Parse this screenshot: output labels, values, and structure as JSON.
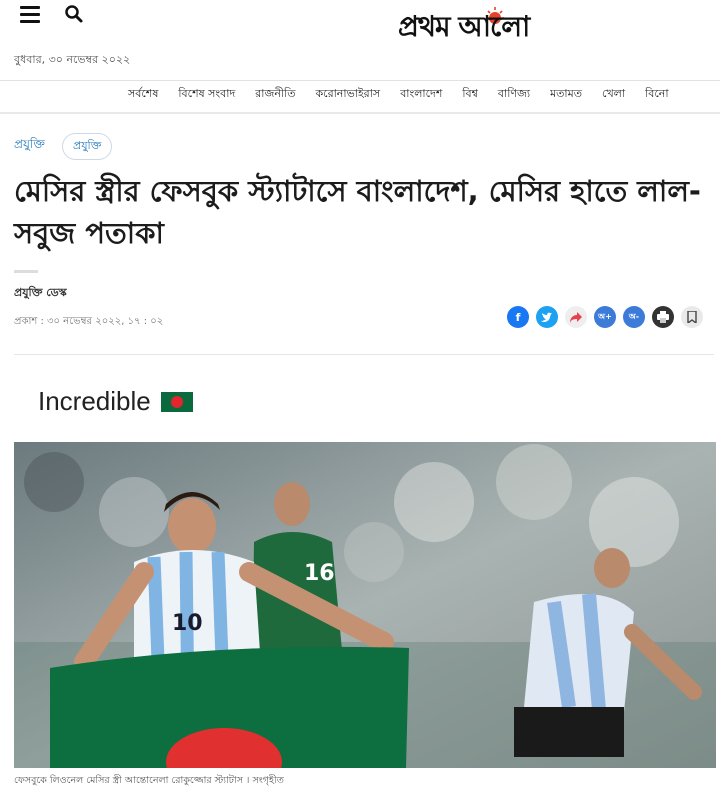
{
  "header": {
    "logo_text": "প্রথম আলো",
    "date": "বুধবার, ৩০ নভেম্বর ২০২২"
  },
  "nav": {
    "items": [
      "সর্বশেষ",
      "বিশেষ সংবাদ",
      "রাজনীতি",
      "করোনাভাইরাস",
      "বাংলাদেশ",
      "বিশ্ব",
      "বাণিজ্য",
      "মতামত",
      "খেলা",
      "বিনো"
    ]
  },
  "article": {
    "category_link": "প্রযুক্তি",
    "category_pill": "প্রযুক্তি",
    "headline": "মেসির স্ত্রীর ফেসবুক স্ট্যাটাসে বাংলাদেশ, মেসির হাতে লাল-সবুজ পতাকা",
    "author": "প্রযুক্তি ডেস্ক",
    "published": "প্রকাশ : ৩০ নভেম্বর ২০২২, ১৭ : ০২",
    "embed_text": "Incredible",
    "caption": "ফেসবুকে লিওনেল মেসির স্ত্রী আন্তোনেলা রোকুজ্জোর স্ট্যাটাস । সংগৃহীত"
  },
  "share": {
    "facebook_color": "#1877f2",
    "twitter_color": "#1da1f2",
    "share_color": "#e8404f",
    "google_color": "#3d7bd8",
    "print_color": "#333333",
    "save_color": "#e9e9e9"
  }
}
